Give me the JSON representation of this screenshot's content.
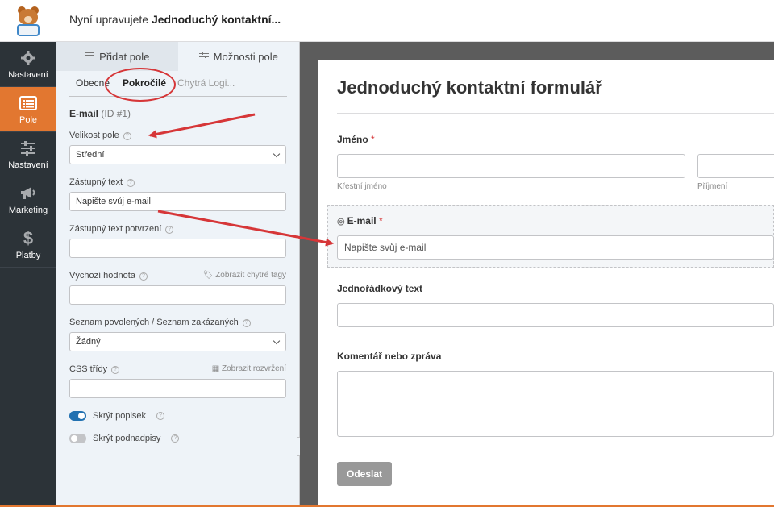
{
  "header": {
    "title_prefix": "Nyní upravujete ",
    "title_form": "Jednoduchý kontaktní..."
  },
  "sidebar": {
    "items": [
      {
        "label": "Nastavení",
        "icon": "gear-icon"
      },
      {
        "label": "Pole",
        "icon": "list-icon"
      },
      {
        "label": "Nastavení",
        "icon": "sliders-icon"
      },
      {
        "label": "Marketing",
        "icon": "megaphone-icon"
      },
      {
        "label": "Platby",
        "icon": "dollar-icon"
      }
    ]
  },
  "panel": {
    "tabs": [
      {
        "label": "Přidat pole",
        "icon": "table-icon"
      },
      {
        "label": "Možnosti pole",
        "icon": "sliders-icon"
      }
    ],
    "subtabs": [
      "Obecné",
      "Pokročilé",
      "Chytrá Logi..."
    ],
    "field_name": "E-mail",
    "field_id": "(ID #1)",
    "size_label": "Velikost pole",
    "size_value": "Střední",
    "placeholder_label": "Zástupný text",
    "placeholder_value": "Napište svůj e-mail",
    "confirm_placeholder_label": "Zástupný text potvrzení",
    "default_label": "Výchozí hodnota",
    "smart_tags_link": "Zobrazit chytré tagy",
    "allowlist_label": "Seznam povolených / Seznam zakázaných",
    "allowlist_value": "Žádný",
    "css_label": "CSS třídy",
    "layouts_link": "Zobrazit rozvržení",
    "hide_label": "Skrýt popisek",
    "hide_sublabels": "Skrýt podnadpisy"
  },
  "preview": {
    "form_title": "Jednoduchý kontaktní formulář",
    "name_label": "Jméno",
    "required_mark": "*",
    "first_name_sub": "Křestní jméno",
    "last_name_sub": "Příjmení",
    "email_label": "E-mail",
    "email_placeholder": "Napište svůj e-mail",
    "single_line_label": "Jednořádkový text",
    "comment_label": "Komentář nebo zpráva",
    "submit_label": "Odeslat"
  },
  "colors": {
    "sidebar_bg": "#2c3338",
    "accent": "#e27730",
    "panel_bg": "#eef3f8",
    "annotation_red": "#d63638",
    "toggle_on": "#2271b1"
  }
}
